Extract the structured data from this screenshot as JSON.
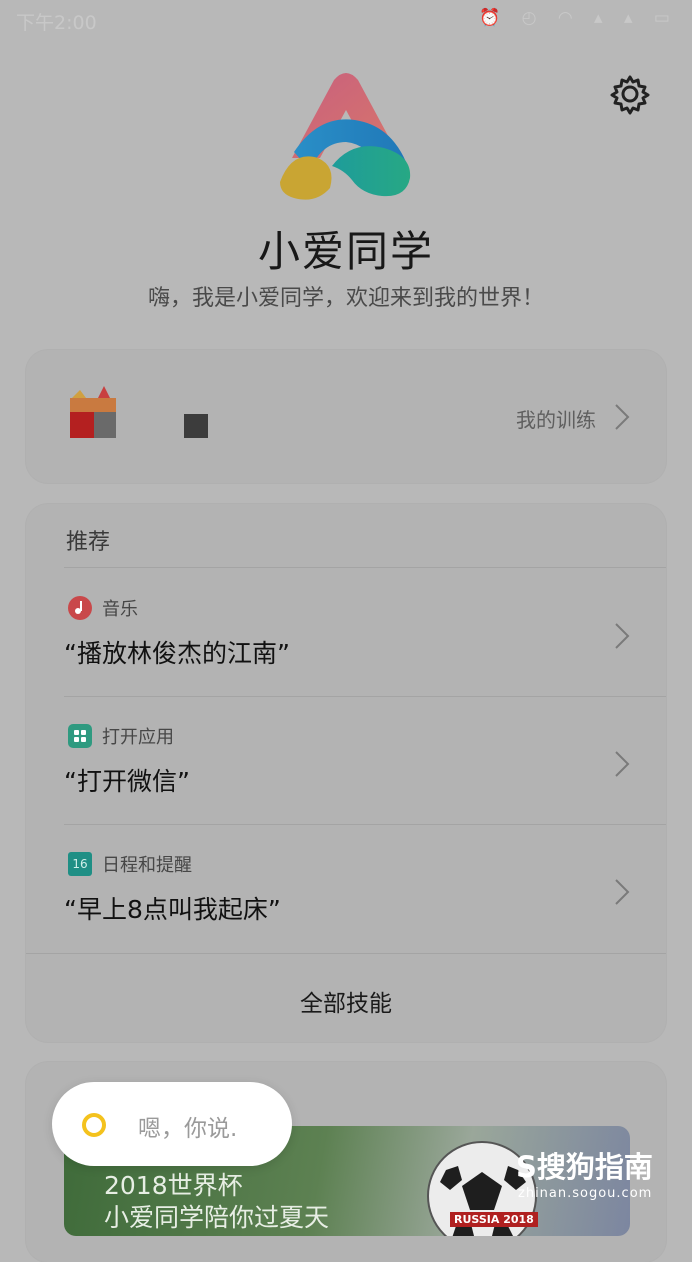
{
  "status_bar": {
    "time": "下午2:00",
    "icons": "⏰ ◴ ◠ ▴ ▴ ▭"
  },
  "app": {
    "title": "小爱同学",
    "subtitle": "嗨，我是小爱同学，欢迎来到我的世界！"
  },
  "training": {
    "label": "我的训练"
  },
  "recommend": {
    "header": "推荐",
    "items": [
      {
        "category": "音乐",
        "icon": "music-icon",
        "command": "“播放林俊杰的江南”"
      },
      {
        "category": "打开应用",
        "icon": "apps-icon",
        "command": "“打开微信”"
      },
      {
        "category": "日程和提醒",
        "icon": "calendar-icon",
        "command": "“早上8点叫我起床”",
        "icon_text": "16"
      }
    ],
    "all_skills": "全部技能"
  },
  "banner": {
    "line1": "2018世界杯",
    "line2": "小爱同学陪你过夏天",
    "tag": "RUSSIA 2018"
  },
  "voice": {
    "text": "嗯，你说."
  },
  "watermark": {
    "logo": "S搜狗指南",
    "url": "zhinan.sogou.com"
  },
  "colors": {
    "accent_yellow": "#f4c21d",
    "music_red": "#c9484a",
    "app_green": "#2f9a80",
    "calendar_teal": "#1f8f85"
  }
}
